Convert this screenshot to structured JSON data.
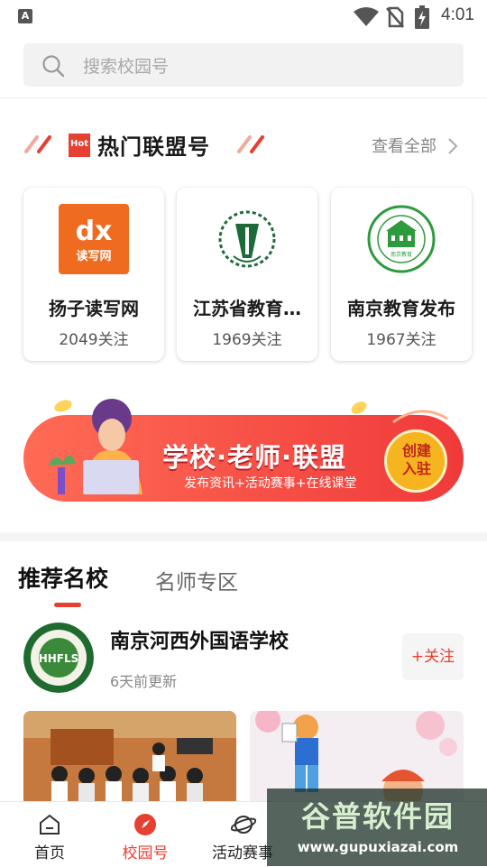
{
  "status_bar": {
    "time": "4:01",
    "a_label": "A"
  },
  "search": {
    "placeholder": "搜索校园号"
  },
  "hot": {
    "badge": "Hot",
    "title": "热门联盟号",
    "see_all": "查看全部",
    "cards": [
      {
        "name": "扬子读写网",
        "fans": "2049关注",
        "logo_text": "读写网"
      },
      {
        "name": "江苏省教育…",
        "fans": "1969关注"
      },
      {
        "name": "南京教育发布",
        "fans": "1967关注",
        "logo_text": "南京教育"
      }
    ]
  },
  "banner": {
    "title": "学校·老师·联盟",
    "subtitle": "发布资讯+活动赛事+在线课堂",
    "button": "创建入驻"
  },
  "tabs": [
    {
      "label": "推荐名校"
    },
    {
      "label": "名师专区"
    }
  ],
  "school": {
    "name": "南京河西外国语学校",
    "updated": "6天前更新",
    "follow": "+关注",
    "logo_text": "HHFLS"
  },
  "nav": [
    {
      "label": "首页",
      "icon": "home-icon"
    },
    {
      "label": "校园号",
      "icon": "compass-icon"
    },
    {
      "label": "活动赛事",
      "icon": "planet-icon"
    }
  ],
  "watermark": {
    "title": "谷普软件园",
    "url": "www.gupuxiazai.com"
  },
  "colors": {
    "accent": "#e64032",
    "search_bg": "#f2f2f2"
  }
}
